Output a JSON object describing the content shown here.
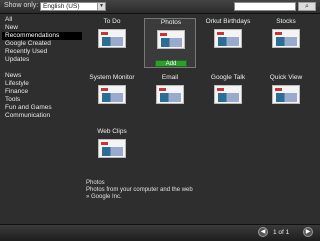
{
  "topbar": {
    "show_only_label": "Show only:",
    "language_value": "English (US)",
    "search_placeholder": "",
    "search_button": "⌕",
    "dropdown_arrow": "▼"
  },
  "sidebar": {
    "group1": [
      "All",
      "New",
      "Recommendations",
      "Google Created",
      "Recently Used",
      "Updates"
    ],
    "group2": [
      "News",
      "Lifestyle",
      "Finance",
      "Tools",
      "Fun and Games",
      "Communication"
    ],
    "selected": "Recommendations"
  },
  "gadgets": [
    {
      "title": "To Do"
    },
    {
      "title": "Photos",
      "add_label": "Add"
    },
    {
      "title": "Orkut Birthdays"
    },
    {
      "title": "Stocks"
    },
    {
      "title": "System Monitor"
    },
    {
      "title": "Email"
    },
    {
      "title": "Google Talk"
    },
    {
      "title": "Quick View"
    },
    {
      "title": "Web Clips"
    }
  ],
  "description": {
    "title": "Photos",
    "line1": "Photos from your computer and the web",
    "line2": "» Google Inc."
  },
  "pagination": {
    "label": "1 of 1",
    "prev": "◀",
    "next": "▶"
  }
}
